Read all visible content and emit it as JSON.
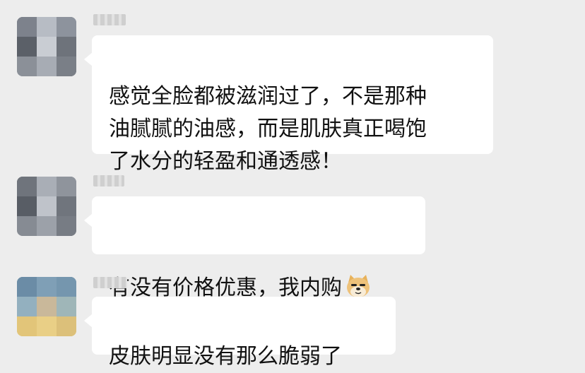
{
  "messages": [
    {
      "text": "感觉全脸都被滋润过了，不是那种\n油腻腻的油感，而是肌肤真正喝饱\n了水分的轻盈和通透感！",
      "emoji": ""
    },
    {
      "text": "有没有价格优惠，我内购",
      "emoji": "doge-emoji"
    },
    {
      "text": "皮肤明显没有那么脆弱了",
      "emoji": ""
    }
  ],
  "colors": {
    "background": "#ededed",
    "bubble": "#ffffff",
    "text": "#111111"
  }
}
